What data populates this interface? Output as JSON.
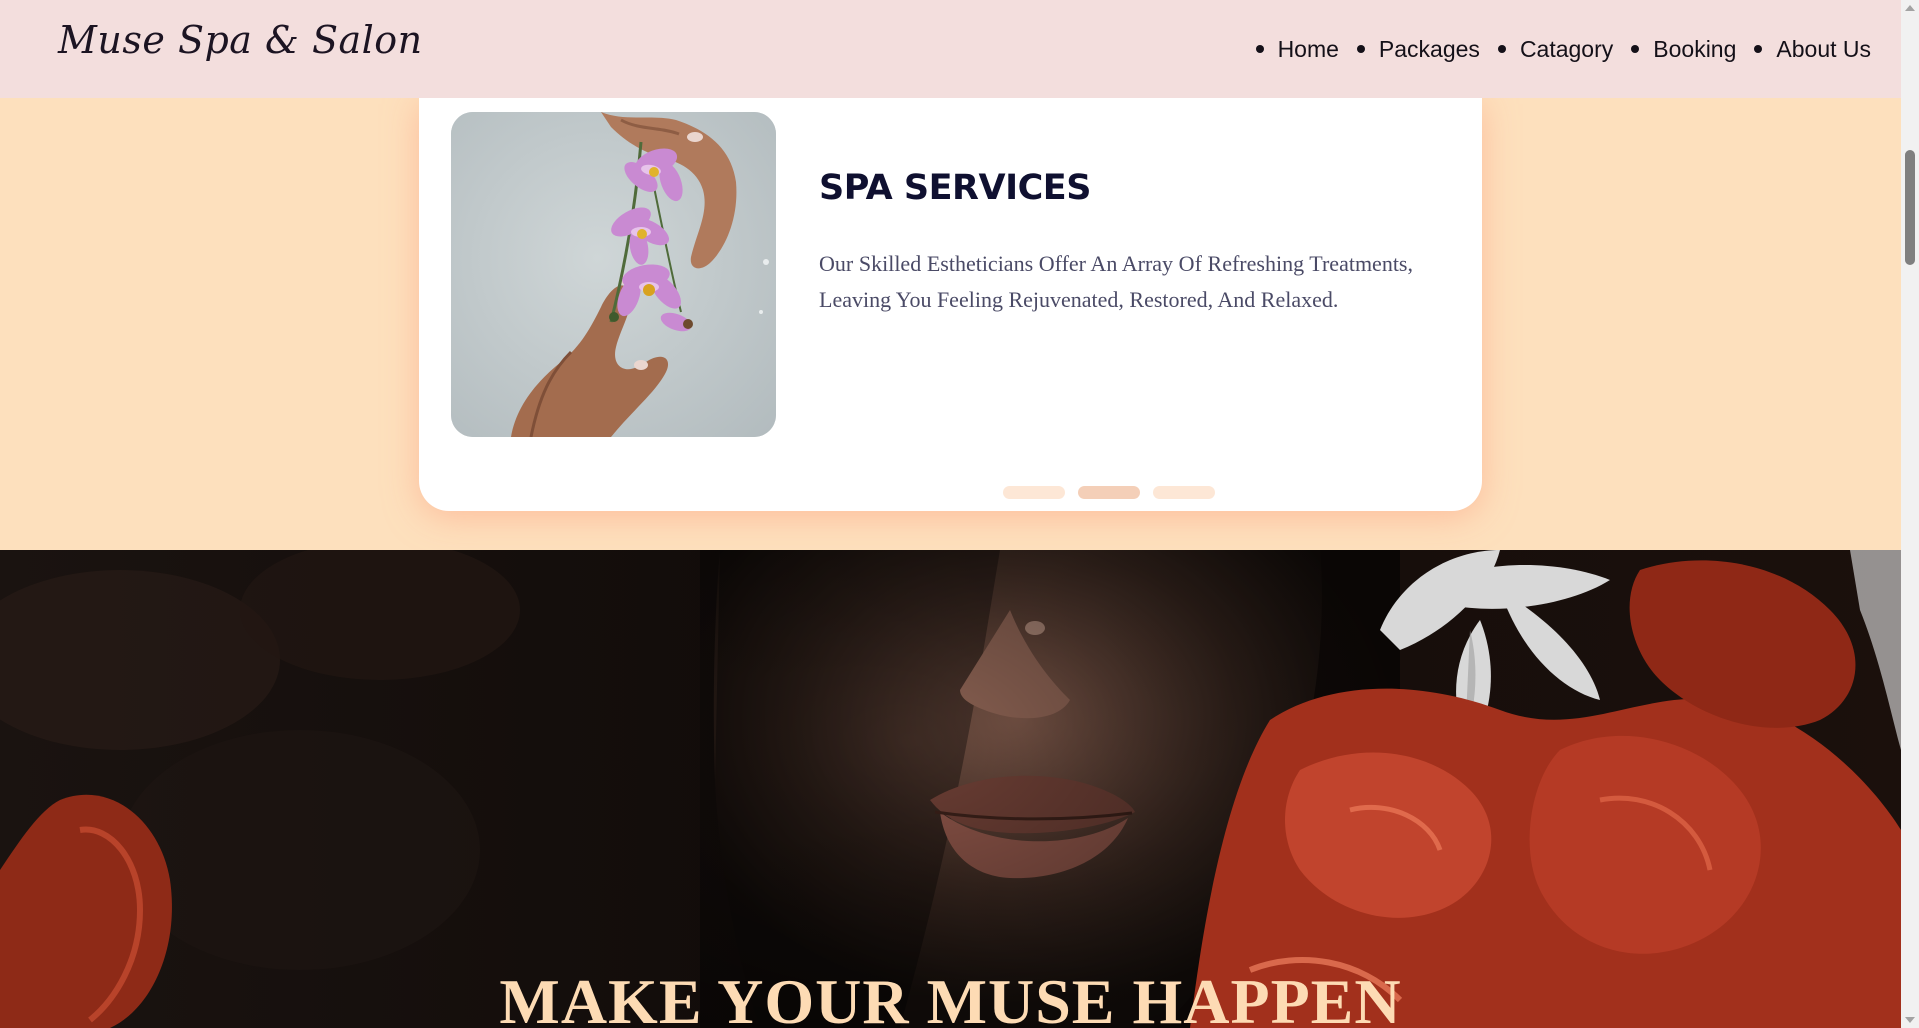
{
  "header": {
    "logo": "Muse Spa & Salon",
    "nav": [
      {
        "label": "Home"
      },
      {
        "label": "Packages"
      },
      {
        "label": "Catagory"
      },
      {
        "label": "Booking"
      },
      {
        "label": "About Us"
      }
    ]
  },
  "service_card": {
    "title": "SPA SERVICES",
    "description": "Our Skilled Estheticians Offer An Array Of Refreshing Treatments, Leaving You Feeling Rejuvenated, Restored, And Relaxed.",
    "slider": {
      "count": 3,
      "active_index": 2
    }
  },
  "hero": {
    "title": "MAKE YOUR MUSE HAPPEN"
  },
  "colors": {
    "header_bg": "#f3dedd",
    "section_bg": "#fde0bd",
    "card_bg": "#ffffff",
    "title_color": "#0f1030",
    "hero_title_color": "#fddbb4"
  }
}
